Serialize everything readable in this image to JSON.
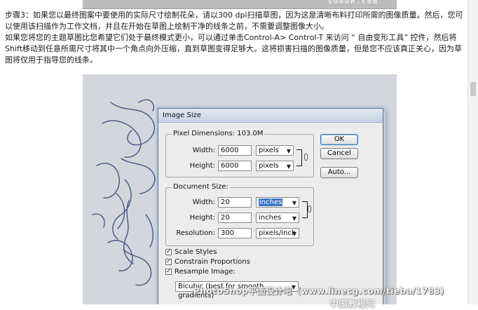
{
  "article": {
    "paragraph1": "步骤3：如果您以最终图案中要使用的实际尺寸绘制花朵，请以300 dpi扫描草图，因为这是清晰布料打印所需的图像质量。然后，您可以使用该扫描作为工作文档，并且在开始在草图上绘制干净的线条之前，不需要调整图像大小。",
    "paragraph2": "如果您将您的主题草图比您希望它们处于最终模式更小，可以通过单击Control-A> Control-T 来访问 “ 自由变形工具” 控件，然后将Shift移动到任意所需尺寸将其中一个角点向外压缩，直到草图变得足够大。这将损害扫描的图像质量，但是您不应该真正关心，因为草图将仅用于指导您的线条。"
  },
  "top_strip": {
    "brand": "SONOH.com"
  },
  "dialog": {
    "title": "Image Size",
    "buttons": {
      "ok": "OK",
      "cancel": "Cancel",
      "auto": "Auto..."
    },
    "pixel_dimensions": {
      "legend": "Pixel Dimensions:  103.0M",
      "width_label": "Width:",
      "width_value": "6000",
      "width_unit": "pixels",
      "height_label": "Height:",
      "height_value": "6000",
      "height_unit": "pixels"
    },
    "document_size": {
      "legend": "Document Size:",
      "width_label": "Width:",
      "width_value": "20",
      "width_unit": "inches",
      "height_label": "Height:",
      "height_value": "20",
      "height_unit": "inches",
      "resolution_label": "Resolution:",
      "resolution_value": "300",
      "resolution_unit": "pixels/inch"
    },
    "options": {
      "scale_styles": {
        "label": "Scale Styles",
        "checked": true
      },
      "constrain_proportions": {
        "label": "Constrain Proportions",
        "checked": true
      },
      "resample_image": {
        "label": "Resample Image:",
        "checked": true
      },
      "resample_method": "Bicubic (best for smooth gradients)"
    }
  },
  "watermark": {
    "text": "PhotoShop平面设计吧（www.linecg.com/tieba/1783）",
    "text2": "中国教程网"
  },
  "colors": {
    "dialog_bg": "#ececec",
    "title_bar": "#c7d4e4",
    "selection": "#3a73c3",
    "sketch_bg": "#d3d6dc"
  }
}
